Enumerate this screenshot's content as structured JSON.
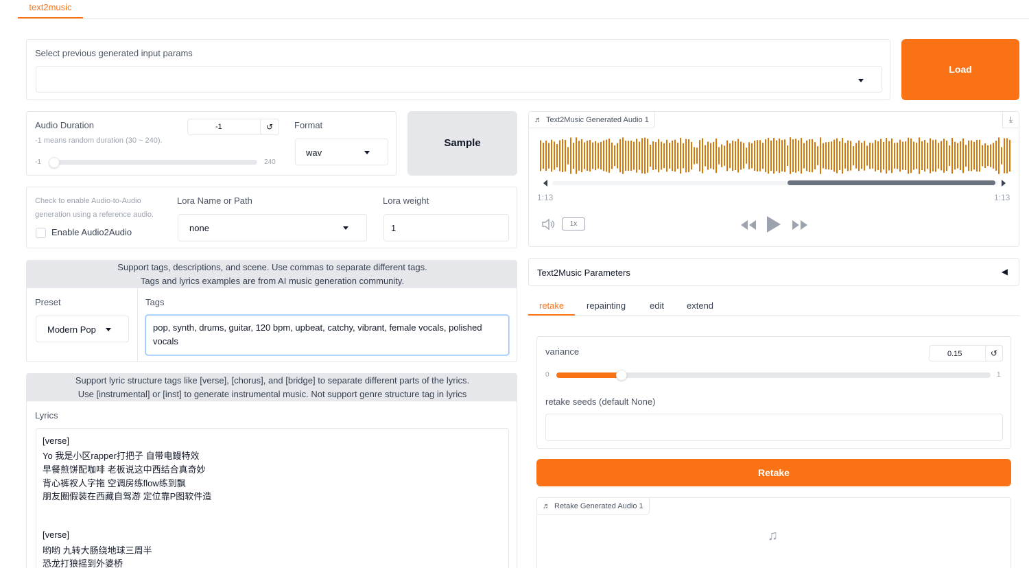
{
  "top_tab": "text2music",
  "history": {
    "label": "Select previous generated input params",
    "value": "",
    "load_label": "Load"
  },
  "duration": {
    "label": "Audio Duration",
    "hint": "-1 means random duration (30 ~ 240).",
    "value": "-1",
    "min": "-1",
    "max": "240",
    "reset_icon": "↺"
  },
  "format": {
    "label": "Format",
    "value": "wav"
  },
  "sample_label": "Sample",
  "audio2audio": {
    "hint_line1": "Check to enable Audio-to-Audio",
    "hint_line2": "generation using a reference audio.",
    "checkbox_label": "Enable Audio2Audio"
  },
  "lora": {
    "name_label": "Lora Name or Path",
    "name_value": "none",
    "weight_label": "Lora weight",
    "weight_value": "1"
  },
  "tags_banner": {
    "line1": "Support tags, descriptions, and scene. Use commas to separate different tags.",
    "line2": "Tags and lyrics examples are from AI music generation community."
  },
  "preset": {
    "label": "Preset",
    "value": "Modern Pop"
  },
  "tags": {
    "label": "Tags",
    "line1": "pop, synth, drums, guitar, 120 bpm, upbeat, catchy, vibrant, female vocals, polished",
    "line2": "vocals"
  },
  "lyrics_banner": {
    "line1": "Support lyric structure tags like [verse], [chorus], and [bridge] to separate different parts of the lyrics.",
    "line2": "Use [instrumental] or [inst] to generate instrumental music. Not support genre structure tag in lyrics"
  },
  "lyrics": {
    "label": "Lyrics",
    "lines": [
      "[verse]",
      "Yo 我是小区rapper打把子 自带电鳗特效",
      "早餐煎饼配咖啡 老板说这中西结合真奇妙",
      "背心裤衩人字拖 空调房练flow练到飘",
      "朋友圈假装在西藏自驾游 定位靠P图软件造",
      "",
      "[verse]",
      "哟哟 九转大肠绕地球三周半",
      "恐龙打狼摇到外婆桥"
    ]
  },
  "audio_player": {
    "label": "Text2Music Generated Audio 1",
    "time_start": "1:13",
    "time_end": "1:13",
    "speed": "1x"
  },
  "params_accordion": {
    "label": "Text2Music Parameters",
    "arrow": "◀"
  },
  "mode_tabs": [
    "retake",
    "repainting",
    "edit",
    "extend"
  ],
  "variance": {
    "label": "variance",
    "value": "0.15",
    "min": "0",
    "max": "1",
    "fraction": 0.15,
    "reset_icon": "↺"
  },
  "retake_seeds": {
    "label": "retake seeds (default None)",
    "value": ""
  },
  "retake_label": "Retake",
  "retake_audio": {
    "label": "Retake Generated Audio 1"
  },
  "colors": {
    "accent": "#f97316",
    "waveform": "#d97706"
  }
}
